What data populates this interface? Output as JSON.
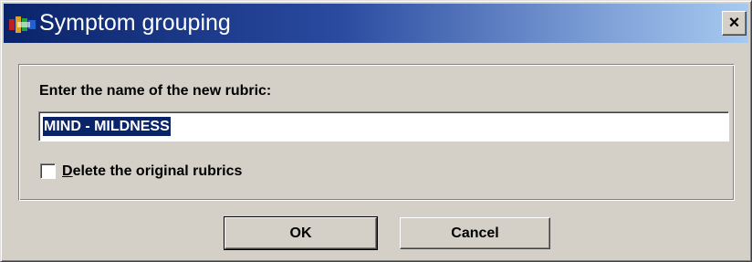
{
  "window": {
    "title": "Symptom grouping",
    "close_glyph": "×",
    "app_icon": "app-logo-icon",
    "titlebar_colors": [
      "#0a246a",
      "#a6caf0"
    ]
  },
  "form": {
    "prompt_label": "Enter the name of the new rubric:",
    "rubric_name_value": "MIND - MILDNESS",
    "rubric_name_selected": true,
    "delete_checkbox": {
      "checked": false,
      "label_accel": "D",
      "label_rest": "elete the original rubrics"
    }
  },
  "buttons": {
    "ok_label": "OK",
    "cancel_label": "Cancel"
  }
}
